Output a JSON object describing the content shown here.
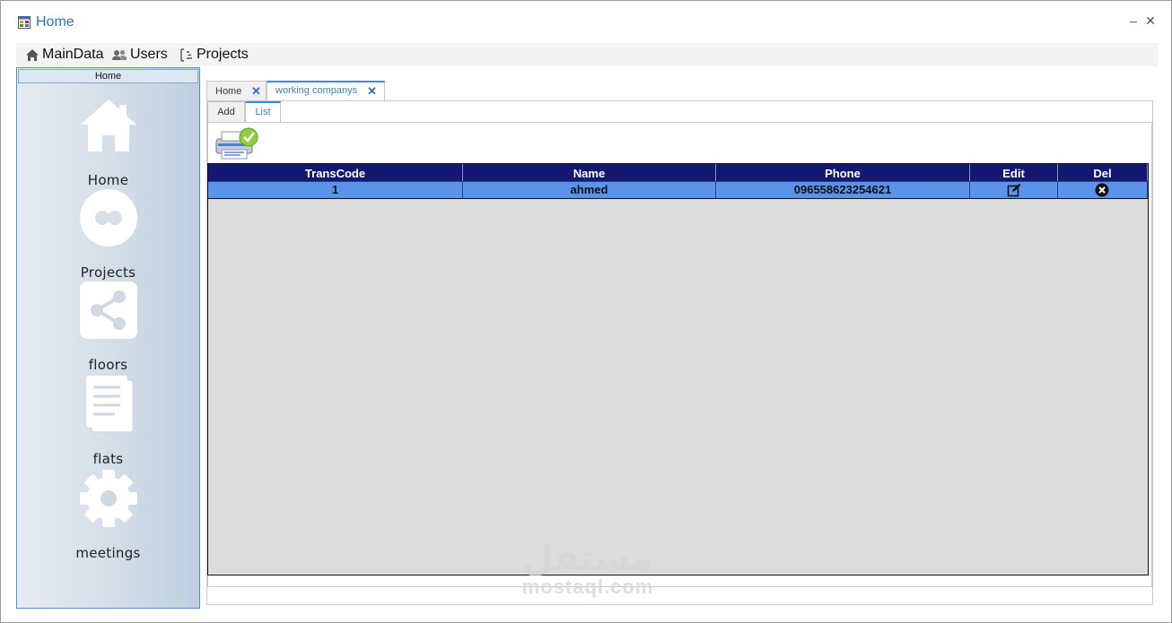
{
  "window": {
    "title": "Home",
    "minimize_glyph": "‒",
    "close_glyph": "✕"
  },
  "menu": {
    "items": [
      {
        "label": "MainData",
        "icon": "home-icon"
      },
      {
        "label": "Users",
        "icon": "users-icon"
      },
      {
        "label": "Projects",
        "icon": "projects-icon"
      }
    ]
  },
  "sidebar": {
    "header": "Home",
    "items": [
      {
        "label": "Home",
        "icon": "home-icon"
      },
      {
        "label": "Projects",
        "icon": "circles-icon"
      },
      {
        "label": "floors",
        "icon": "share-icon"
      },
      {
        "label": "flats",
        "icon": "document-icon"
      },
      {
        "label": "meetings",
        "icon": "gear-icon"
      }
    ]
  },
  "tabs": [
    {
      "label": "Home",
      "active": false
    },
    {
      "label": "working companys",
      "active": true
    }
  ],
  "subtabs": [
    {
      "label": "Add",
      "active": false
    },
    {
      "label": "List",
      "active": true
    }
  ],
  "grid": {
    "columns": [
      "TransCode",
      "Name",
      "Phone",
      "Edit",
      "Del"
    ],
    "rows": [
      {
        "TransCode": "1",
        "Name": "ahmed",
        "Phone": "096558623254621",
        "edit_icon": "edit-icon",
        "del_icon": "delete-icon"
      }
    ]
  },
  "watermark": {
    "arabic": "مستقل",
    "latin": "mostaql.com"
  },
  "colors": {
    "title": "#2d6fb7",
    "grid_header": "#141870",
    "grid_row": "#5a93ea",
    "grid_bg": "#dcdcdc",
    "accent": "#3c8bd8"
  }
}
